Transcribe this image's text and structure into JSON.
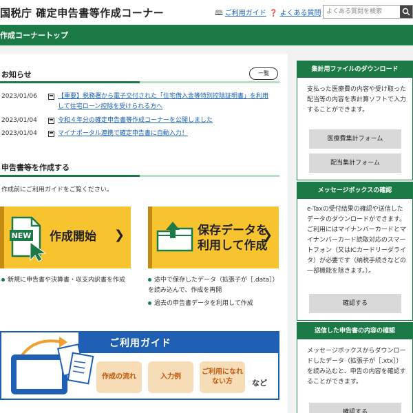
{
  "header": {
    "title": "国税庁 確定申告書等作成コーナー",
    "guide_link": "ご利用ガイド",
    "faq_link": "よくある質問",
    "search_placeholder": "よくある質問を検索"
  },
  "topbar": {
    "title": "作成コーナートップ"
  },
  "notices": {
    "title": "お知らせ",
    "list_button": "一覧",
    "items": [
      {
        "date": "2023/01/06",
        "text": "【重要】税務署から電子交付された「住宅借入金等特別控除証明書」を利用して住宅ローン控除を受けられる方へ"
      },
      {
        "date": "2023/01/04",
        "text": "令和４年分の確定申告書等作成コーナーを公開しました"
      },
      {
        "date": "2023/01/04",
        "text": "マイナポータル連携で確定申告書に自動入力！"
      }
    ]
  },
  "create": {
    "title": "申告書等を作成する",
    "intro": "作成前にご利用ガイドをご覧ください。",
    "start_card": {
      "badge": "NEW",
      "label": "作成開始",
      "bullet": "新規に申告書や決算書・収支内訳書を作成"
    },
    "saved_card": {
      "label_line1": "保存データを",
      "label_line2": "利用して作成",
      "bullet1": "途中で保存したデータ（拡張子が［.data］）を読み込んで、作成を再開",
      "bullet2": "過去の申告書データを利用して作成"
    }
  },
  "guide_banner": {
    "title": "ご利用ガイド",
    "box1": "作成の流れ",
    "box2": "入力例",
    "box3": "ご利用になれない方",
    "suffix": "など"
  },
  "sidebar": {
    "download": {
      "title": "集計用ファイルのダウンロード",
      "text": "支払った医療費の内容や受け取った配当等の内容を表計算ソフトで入力することができます。",
      "button1": "医療費集計フォーム",
      "button2": "配当集計フォーム"
    },
    "messagebox": {
      "title": "メッセージボックスの確認",
      "text": "e-Taxの受付結果の確認や送信したデータのダウンロードができます。ご利用にはマイナンバーカードとマイナンバーカード読取対応のスマートフォン（又はICカードリーダライタ）が必要です（納税手続きなどの一部機能を除きます。）。",
      "button": "確認する"
    },
    "sent": {
      "title": "送信した申告書の内容の確認",
      "text": "メッセージボックスからダウンロードしたデータ（拡張子が［.xtx］）を読み込むと、申告の内容を確認することができます。",
      "button": "確認する"
    }
  }
}
